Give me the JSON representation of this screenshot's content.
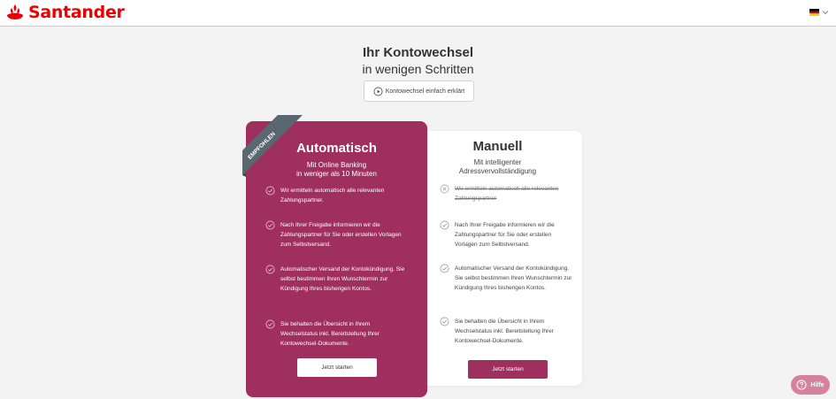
{
  "header": {
    "brand": "Santander",
    "language": "DE"
  },
  "hero": {
    "title": "Ihr Kontowechsel",
    "subtitle": "in wenigen Schritten",
    "explain_button": "Kontowechsel einfach erklärt"
  },
  "cards": {
    "automatic": {
      "ribbon": "EMPFOHLEN",
      "title": "Automatisch",
      "subtitle_line1": "Mit Online Banking",
      "subtitle_line2": "in weniger als 10 Minuten",
      "features": [
        "Wir ermitteln automatisch alle relevanten Zahlungspartner.",
        "Nach Ihrer Freigabe informieren wir die Zahlungspartner für Sie oder erstellen Vorlagen zum Selbstversand.",
        "Automatischer Versand der Kontokündigung. Sie selbst bestimmen Ihren Wunschtermin zur Kündigung Ihres bisherigen Kontos.",
        "Sie behalten die Übersicht in Ihrem Wechselstatus inkl. Bereitstellung Ihrer Kontowechsel-Dokumente."
      ],
      "button": "Jetzt starten"
    },
    "manual": {
      "title": "Manuell",
      "subtitle_line1": "Mit intelligenter",
      "subtitle_line2": "Adressvervollständigung",
      "features": [
        "Wir ermitteln automatisch alle relevanten Zahlungspartner",
        "Nach Ihrer Freigabe informieren wir die Zahlungspartner für Sie oder erstellen Vorlagen zum Selbstversand.",
        "Automatischer Versand der Kontokündigung. Sie selbst bestimmen Ihren Wunschtermin zur Kündigung Ihres bisherigen Kontos.",
        "Sie behalten die Übersicht in Ihrem Wechselstatus inkl. Bereitstellung Ihrer Kontowechsel-Dokumente."
      ],
      "button": "Jetzt starten"
    }
  },
  "help": {
    "label": "Hilfe"
  },
  "colors": {
    "brand_red": "#ec0000",
    "card_primary": "#9e2f5f",
    "ribbon": "#5a6670",
    "help_button": "#d6829f"
  },
  "icons": {
    "logo": "santander-flame-icon",
    "language": "german-flag-icon",
    "explain": "play-circle-icon",
    "feature_ok": "check-circle-icon",
    "feature_missing": "x-circle-icon",
    "help": "question-circle-icon"
  }
}
